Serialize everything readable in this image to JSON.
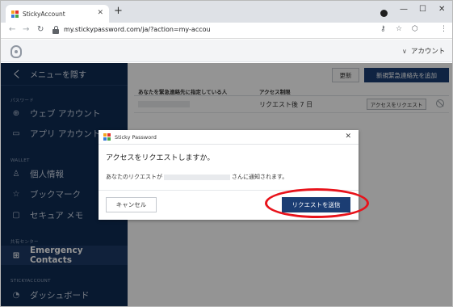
{
  "browser": {
    "tab_title": "StickyAccount",
    "tab_close": "✕",
    "new_tab": "+",
    "url": "my.stickypassword.com/ja/?action=my-accou",
    "minimize": "—",
    "maximize": "☐",
    "close": "✕",
    "back": "←",
    "forward": "→",
    "reload": "↻",
    "key_icon": "⚷",
    "star_icon": "☆",
    "ext_icon": "⬡",
    "menu_icon": "⋮"
  },
  "header": {
    "account_label": "アカウント",
    "account_chevron": "∨"
  },
  "sidebar": {
    "menu_chevron": "く",
    "menu_label": "メニューを隠す",
    "sections": {
      "password": "パスワード",
      "wallet": "WALLET",
      "share": "共有センター",
      "stickyaccount": "STICKYACCOUNT"
    },
    "items": [
      {
        "icon": "globe-icon",
        "glyph": "⊕",
        "label": "ウェブ アカウント"
      },
      {
        "icon": "laptop-icon",
        "glyph": "▭",
        "label": "アプリ アカウント"
      },
      {
        "icon": "person-icon",
        "glyph": "♙",
        "label": "個人情報"
      },
      {
        "icon": "star-icon",
        "glyph": "☆",
        "label": "ブックマーク"
      },
      {
        "icon": "note-icon",
        "glyph": "▢",
        "label": "セキュア メモ"
      },
      {
        "icon": "plus-box-icon",
        "glyph": "⊞",
        "label": "Emergency Contacts"
      },
      {
        "icon": "speedometer-icon",
        "glyph": "◔",
        "label": "ダッシュボード"
      }
    ]
  },
  "main": {
    "update_button": "更新",
    "add_button": "新規緊急連絡先を追加",
    "columns": [
      "あなたを緊急連絡先に指定している人",
      "アクセス制限"
    ],
    "row": {
      "status": "リクエスト後 7 日",
      "action": "アクセスをリクエスト"
    }
  },
  "modal": {
    "title": "Sticky Password",
    "close": "✕",
    "heading": "アクセスをリクエストしますか。",
    "text_before": "あなたのリクエストが",
    "text_after": "さんに通知されます。",
    "cancel": "キャンセル",
    "send": "リクエストを送信"
  },
  "colors": {
    "sidebar_bg": "#0f2b54",
    "primary_button": "#1b3d73",
    "highlight_ring": "#e8131b"
  }
}
